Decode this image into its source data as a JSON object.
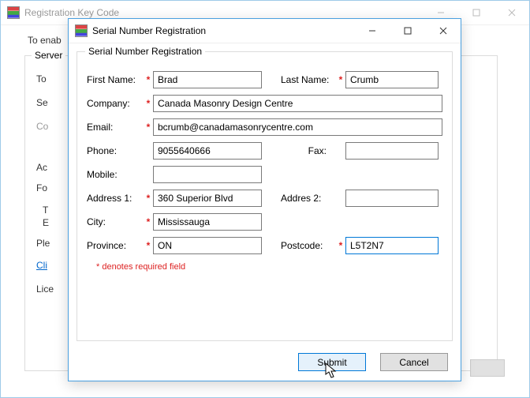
{
  "backWindow": {
    "title": "Registration Key Code",
    "introFragment": "To enab",
    "groupLabel": "Server",
    "lines": {
      "to": "To",
      "se": "Se",
      "co": "Co",
      "ac": "Ac",
      "fo": "Fo",
      "t": "T",
      "e": "E",
      "ple": "Ple",
      "cli": "Cli",
      "lice": "Lice"
    }
  },
  "frontWindow": {
    "title": "Serial Number Registration",
    "groupLabel": "Serial Number Registration",
    "labels": {
      "firstName": "First Name:",
      "lastName": "Last Name:",
      "company": "Company:",
      "email": "Email:",
      "phone": "Phone:",
      "fax": "Fax:",
      "mobile": "Mobile:",
      "address1": "Address 1:",
      "address2": "Addres 2:",
      "city": "City:",
      "province": "Province:",
      "postcode": "Postcode:"
    },
    "values": {
      "firstName": "Brad",
      "lastName": "Crumb",
      "company": "Canada Masonry Design Centre",
      "email": "bcrumb@canadamasonrycentre.com",
      "phone": "9055640666",
      "fax": "",
      "mobile": "",
      "address1": "360 Superior Blvd",
      "address2": "",
      "city": "Mississauga",
      "province": "ON",
      "postcode": "L5T2N7"
    },
    "requiredNote": "*   denotes required field",
    "buttons": {
      "submit": "Submit",
      "cancel": "Cancel"
    }
  }
}
